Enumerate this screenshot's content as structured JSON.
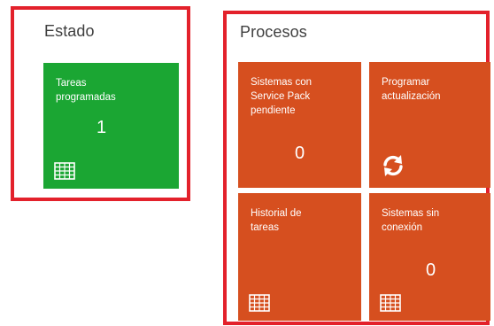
{
  "estado": {
    "title": "Estado",
    "tiles": [
      {
        "label": "Tareas\nprogramadas",
        "count": "1",
        "icon": "grid-icon",
        "color": "#1ba633"
      }
    ]
  },
  "procesos": {
    "title": "Procesos",
    "tiles": [
      {
        "label": "Sistemas con\nService Pack\npendiente",
        "count": "0",
        "color": "#d64f1f"
      },
      {
        "label": "Programar\nactualización",
        "icon": "sync-icon",
        "color": "#d64f1f"
      },
      {
        "label": "Historial de\ntareas",
        "icon": "grid-icon",
        "color": "#d64f1f"
      },
      {
        "label": "Sistemas sin\nconexión",
        "count": "0",
        "icon": "grid-icon",
        "color": "#d64f1f"
      }
    ]
  },
  "highlight_color": "#e3212b"
}
